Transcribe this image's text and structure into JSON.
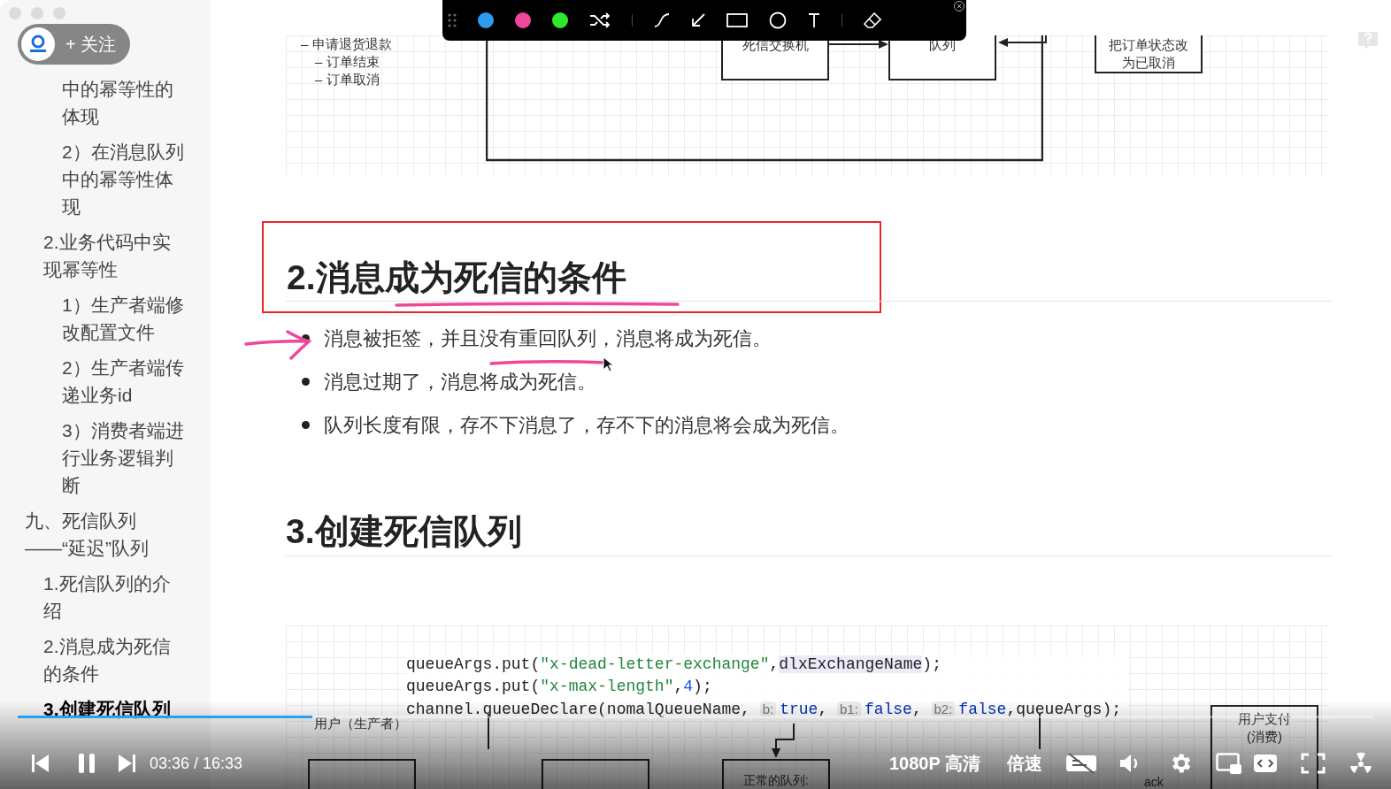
{
  "follow_button": {
    "label": "+ 关注"
  },
  "outline": {
    "items": [
      {
        "children": [
          {
            "children": [
              {
                "text": "中的幂等性的体现",
                "selected": false
              },
              {
                "text": "2）在消息队列中的幂等性体现",
                "selected": false
              }
            ]
          },
          {
            "text": "2.业务代码中实现幂等性",
            "selected": false,
            "children": [
              {
                "text": "1）生产者端修改配置文件",
                "selected": false
              },
              {
                "text": "2）生产者端传递业务id",
                "selected": false
              },
              {
                "text": "3）消费者端进行业务逻辑判断",
                "selected": false
              }
            ]
          }
        ]
      },
      {
        "text": "九、死信队列——“延迟”队列",
        "selected": false,
        "children": [
          {
            "text": "1.死信队列的介绍",
            "selected": false
          },
          {
            "text": "2.消息成为死信的条件",
            "selected": false
          },
          {
            "text": "3.创建死信队列",
            "selected": true
          }
        ]
      }
    ]
  },
  "pen_toolbar": {
    "colors": [
      {
        "color": "#2d9bf0",
        "selected": false
      },
      {
        "color": "#f0479b",
        "selected": false
      },
      {
        "color": "#2ee82e",
        "selected": false
      }
    ]
  },
  "top_diagram": {
    "list": [
      "– 申请退货退款",
      "– 订单结束",
      "– 订单取消"
    ],
    "nodes": [
      "死信交换机",
      "队列",
      "把订单状态改为已取消"
    ]
  },
  "section_2": {
    "heading": "2.消息成为死信的条件",
    "bullets": [
      "消息被拒签，并且没有重回队列，消息将成为死信。",
      "消息过期了，消息将成为死信。",
      "队列长度有限，存不下消息了，存不下的消息将会成为死信。"
    ]
  },
  "section_3": {
    "heading": "3.创建死信队列"
  },
  "code": {
    "lines": [
      [
        {
          "kind": "plain",
          "text": "queueArgs.put("
        },
        {
          "kind": "string",
          "text": "\"x-dead-letter-exchange\""
        },
        {
          "kind": "plain",
          "text": ","
        },
        {
          "kind": "highlight",
          "text": "dlxExchangeName"
        },
        {
          "kind": "plain",
          "text": ");"
        }
      ],
      [
        {
          "kind": "plain",
          "text": "queueArgs.put("
        },
        {
          "kind": "string",
          "text": "\"x-max-length\""
        },
        {
          "kind": "plain",
          "text": ","
        },
        {
          "kind": "number",
          "text": "4"
        },
        {
          "kind": "plain",
          "text": ");"
        }
      ],
      [
        {
          "kind": "plain",
          "text": "channel.queueDeclare(nomalQueueName, "
        },
        {
          "kind": "hint",
          "text": "b:"
        },
        {
          "kind": "keyword",
          "text": "true"
        },
        {
          "kind": "plain",
          "text": ", "
        },
        {
          "kind": "hint",
          "text": "b1:"
        },
        {
          "kind": "keyword",
          "text": "false"
        },
        {
          "kind": "plain",
          "text": ", "
        },
        {
          "kind": "hint",
          "text": "b2:"
        },
        {
          "kind": "keyword",
          "text": "false"
        },
        {
          "kind": "plain",
          "text": ",queueArgs);"
        }
      ]
    ]
  },
  "bottom_diagram": {
    "producer_label": "用户（生产者）",
    "queue_label": "正常的队列:",
    "consumer_label": "用户支付(消费)",
    "ack_label": "ack"
  },
  "player": {
    "level": 0.2175,
    "playing": true,
    "time": "03:36 / 16:33",
    "quality": "1080P 高清",
    "speed": "倍速",
    "subtitles_on": false
  }
}
